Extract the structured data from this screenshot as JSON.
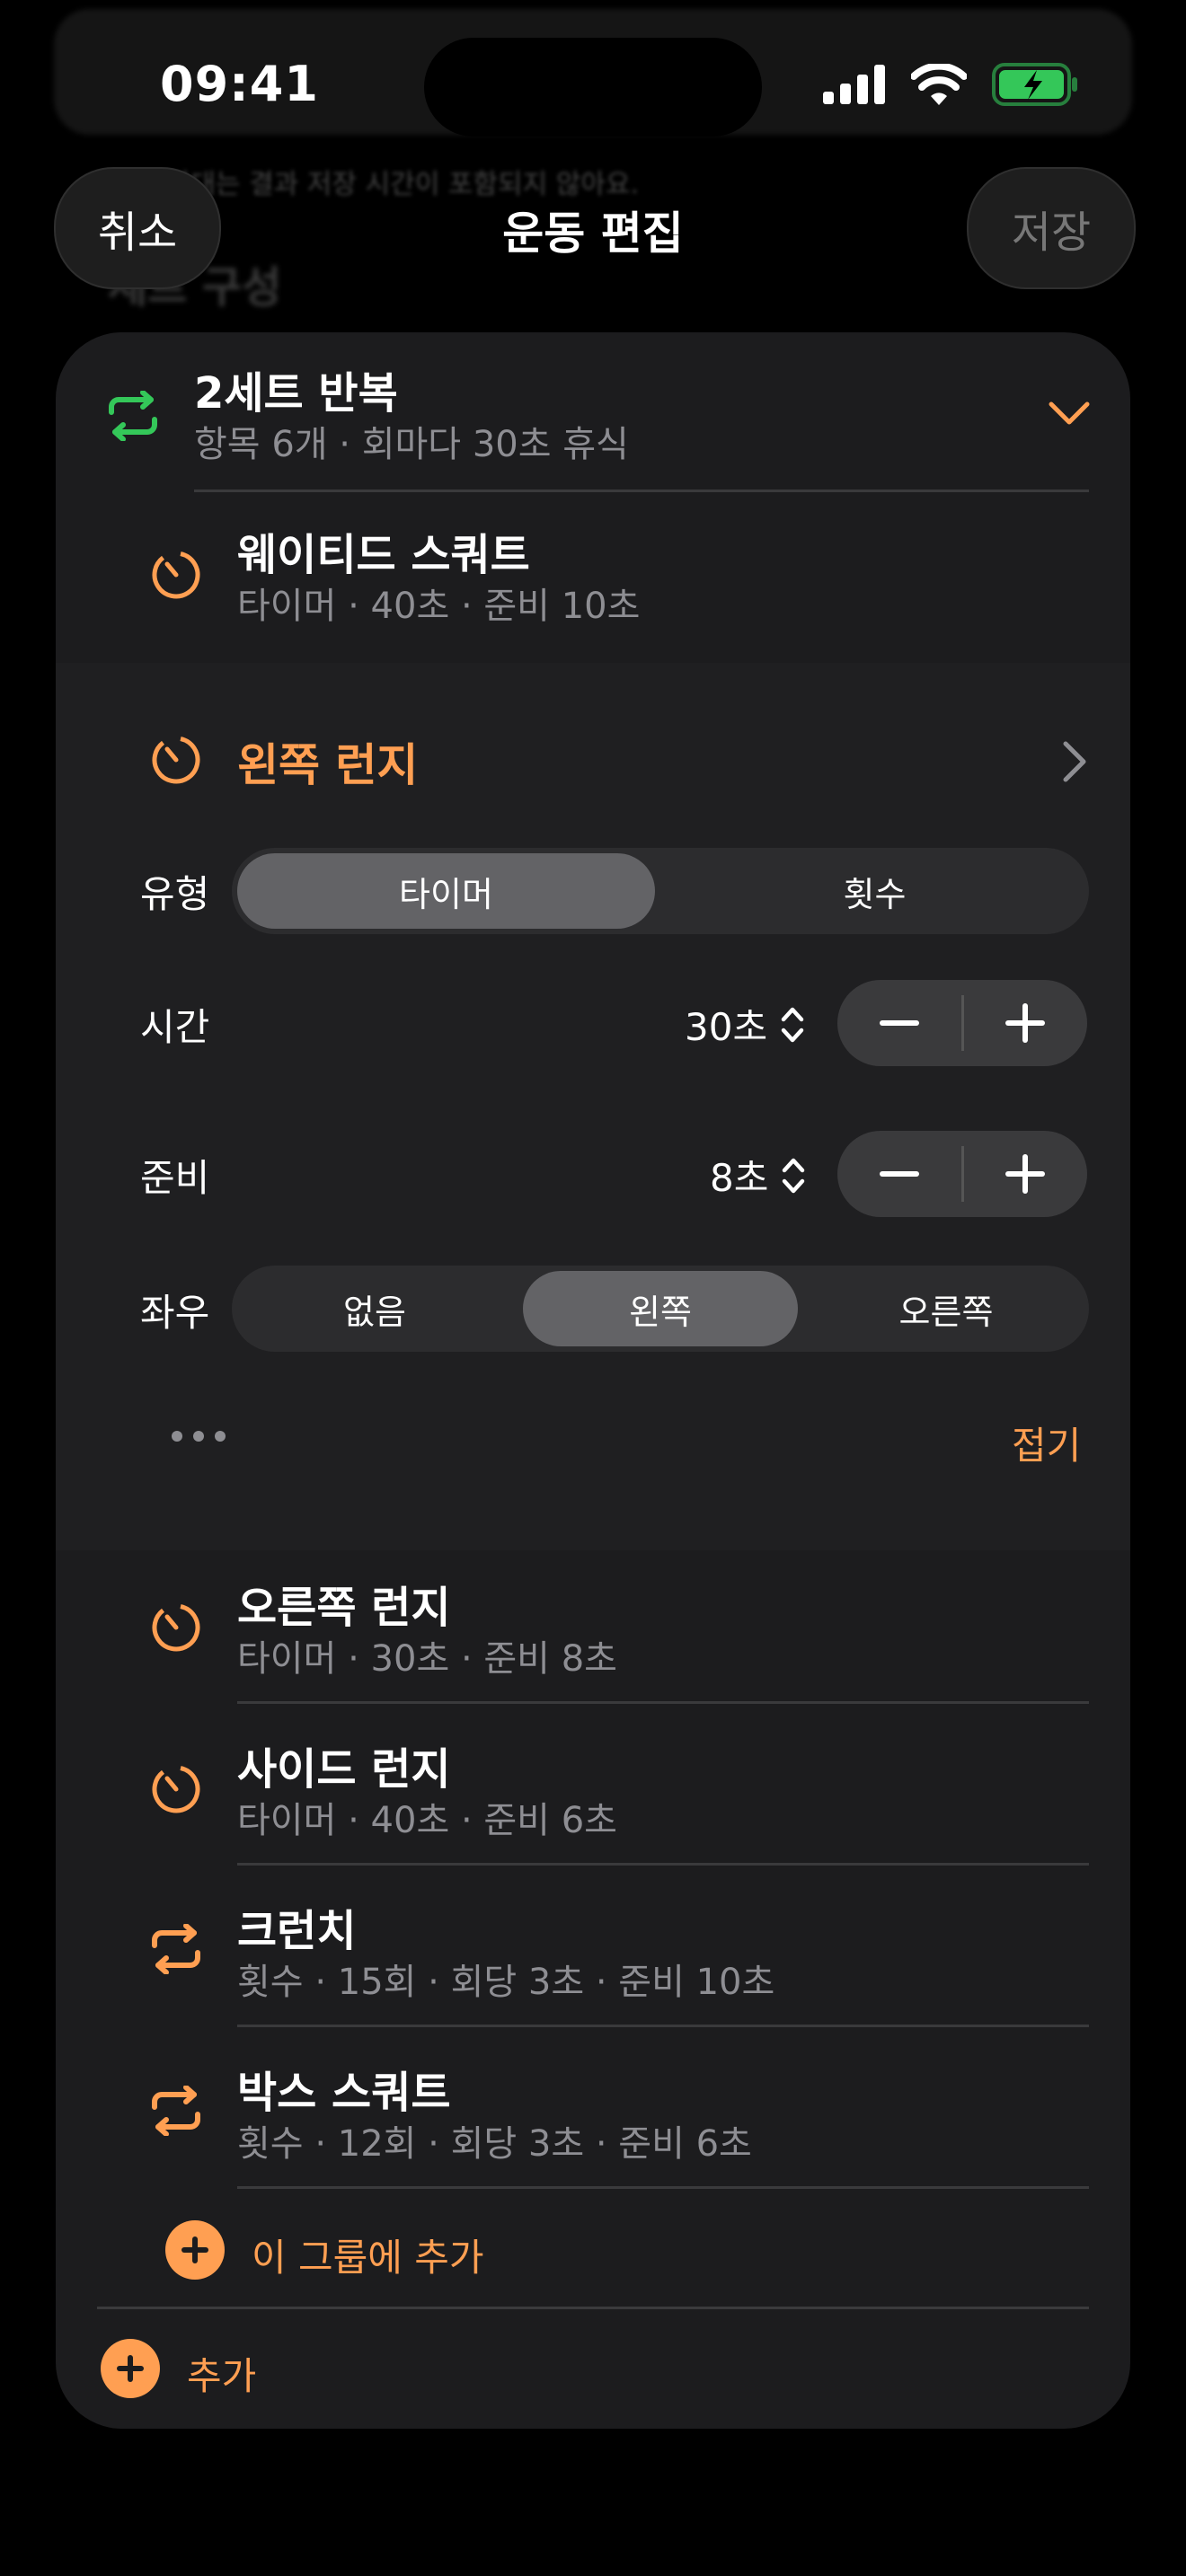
{
  "status": {
    "time": "09:41"
  },
  "background": {
    "heading": "세트 구성",
    "note": "각 시간대는 결과 저장 시간이 포함되지 않아요."
  },
  "nav": {
    "cancel": "취소",
    "title": "운동 편집",
    "save": "저장"
  },
  "group": {
    "title": "2세트 반복",
    "subtitle": "항목 6개 · 회마다 30초 휴식",
    "items": [
      {
        "name": "웨이티드 스쿼트",
        "detail": "타이머 · 40초 · 준비 10초",
        "icon": "timer-icon"
      },
      {
        "name": "오른쪽 런지",
        "detail": "타이머 · 30초 · 준비 8초",
        "icon": "timer-icon"
      },
      {
        "name": "사이드 런지",
        "detail": "타이머 · 40초 · 준비 6초",
        "icon": "timer-icon"
      },
      {
        "name": "크런치",
        "detail": "횟수 · 15회 · 회당 3초 · 준비 10초",
        "icon": "repeat-icon"
      },
      {
        "name": "박스 스쿼트",
        "detail": "횟수 · 12회 · 회당 3초 · 준비 6초",
        "icon": "repeat-icon"
      }
    ],
    "add_to_group": "이 그룹에 추가"
  },
  "editor": {
    "name": "왼쪽 런지",
    "type_label": "유형",
    "type_options": [
      "타이머",
      "횟수"
    ],
    "type_selected": "타이머",
    "time_label": "시간",
    "time_value": "30초",
    "prep_label": "준비",
    "prep_value": "8초",
    "side_label": "좌우",
    "side_options": [
      "없음",
      "왼쪽",
      "오른쪽"
    ],
    "side_selected": "왼쪽",
    "collapse": "접기"
  },
  "add": "추가",
  "colors": {
    "accent": "#ff9f52",
    "green": "#34c759",
    "card": "#1c1c1e"
  }
}
